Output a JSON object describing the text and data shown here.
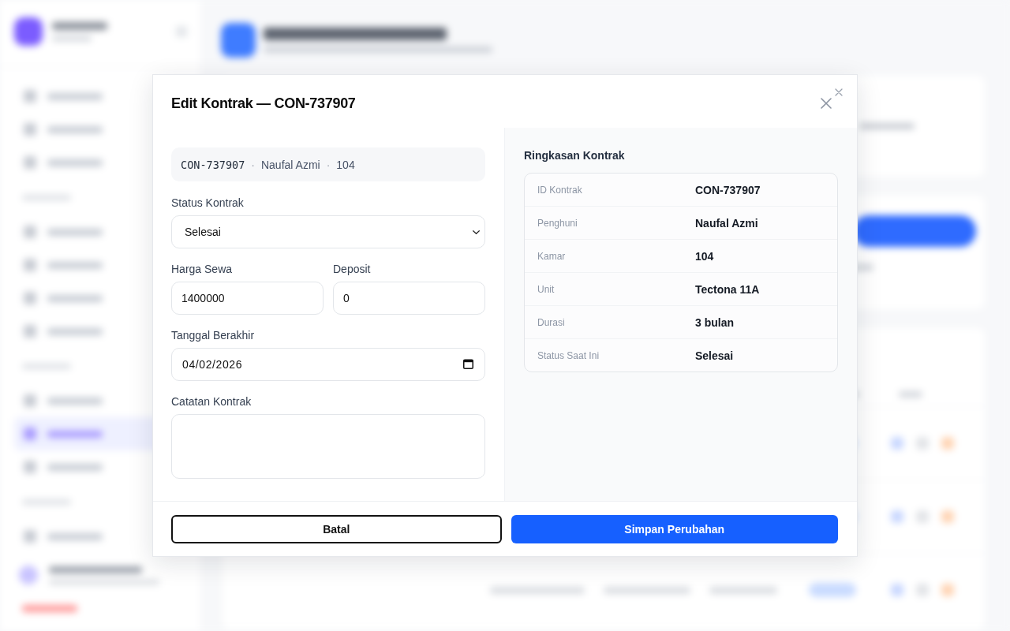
{
  "modal": {
    "title": "Edit Kontrak — CON-737907"
  },
  "chip": [
    {
      "text": "CON-737907",
      "kind": "mono"
    },
    {
      "text": "·",
      "kind": "separator"
    },
    {
      "text": "Naufal Azmi",
      "kind": "text"
    },
    {
      "text": "·",
      "kind": "separator"
    },
    {
      "text": "104",
      "kind": "text"
    }
  ],
  "form_rows": [
    {
      "fields": [
        {
          "kind": "select",
          "label": "Status Kontrak",
          "value": "Selesai"
        }
      ]
    },
    {
      "fields": [
        {
          "kind": "text",
          "label": "Harga Sewa",
          "value": "1400000"
        },
        {
          "kind": "text",
          "label": "Deposit",
          "value": "0"
        }
      ]
    },
    {
      "fields": [
        {
          "kind": "date",
          "label": "Tanggal Berakhir",
          "value": "04/02/2026"
        }
      ]
    },
    {
      "fields": [
        {
          "kind": "textarea",
          "label": "Catatan Kontrak"
        }
      ]
    }
  ],
  "summary": {
    "title": "Ringkasan Kontrak",
    "rows": [
      {
        "label": "ID Kontrak",
        "value": "CON-737907"
      },
      {
        "label": "Penghuni",
        "value": "Naufal Azmi"
      },
      {
        "label": "Kamar",
        "value": "104"
      },
      {
        "label": "Unit",
        "value": "Tectona 11A"
      },
      {
        "label": "Durasi",
        "value": "3 bulan"
      },
      {
        "label": "Status Saat Ini",
        "value": "Selesai"
      }
    ]
  },
  "footer": {
    "buttons": [
      {
        "label": "Batal",
        "kind": "secondary"
      },
      {
        "label": "Simpan Perubahan",
        "kind": "primary"
      }
    ]
  }
}
